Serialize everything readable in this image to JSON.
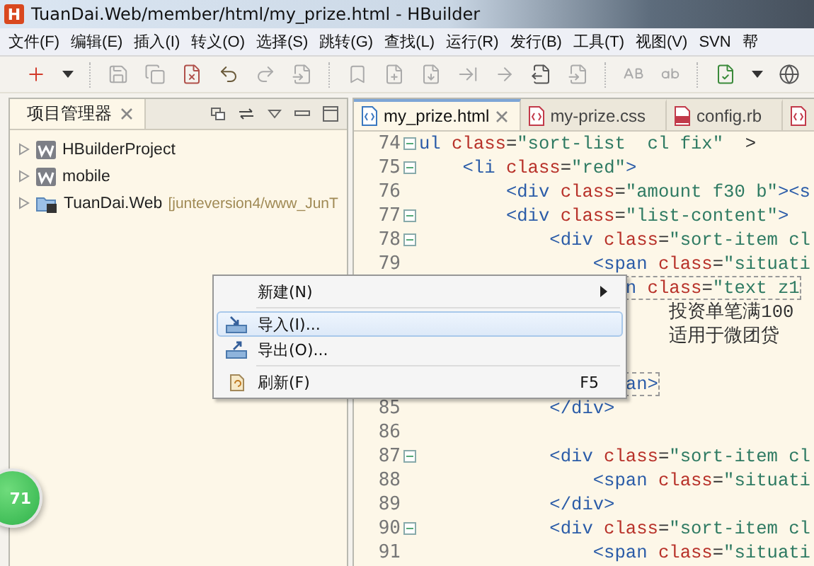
{
  "window": {
    "icon_letter": "H",
    "title": "TuanDai.Web/member/html/my_prize.html  -  HBuilder"
  },
  "menu_bar": [
    "文件(F)",
    "编辑(E)",
    "插入(I)",
    "转义(O)",
    "选择(S)",
    "跳转(G)",
    "查找(L)",
    "运行(R)",
    "发行(B)",
    "工具(T)",
    "视图(V)",
    "SVN",
    "帮"
  ],
  "project_panel": {
    "title": "项目管理器",
    "items": [
      {
        "kind": "web",
        "label": "HBuilderProject",
        "expanded": false
      },
      {
        "kind": "web",
        "label": "mobile",
        "expanded": false
      },
      {
        "kind": "linked",
        "label": "TuanDai.Web",
        "detail": "[junteversion4/www_JunT",
        "expanded": false
      }
    ]
  },
  "editor": {
    "tabs": [
      {
        "kind": "html",
        "label": "my_prize.html",
        "selected": true
      },
      {
        "kind": "css",
        "label": "my-prize.css",
        "selected": false
      },
      {
        "kind": "ruby",
        "label": "config.rb",
        "selected": false
      },
      {
        "kind": "css",
        "selected": false
      }
    ],
    "lines": [
      {
        "number": "74",
        "fold": true,
        "tokens": [
          {
            "kind": "tag",
            "text": "ul"
          },
          {
            "kind": "attr",
            "text": " class"
          },
          {
            "kind": "plain",
            "text": "="
          },
          {
            "kind": "str",
            "text": "\"sort-list  cl fix\""
          },
          {
            "kind": "plain",
            "text": "  >"
          }
        ]
      },
      {
        "number": "75",
        "fold": true,
        "tokens": [
          {
            "kind": "tag",
            "text": "    <li"
          },
          {
            "kind": "attr",
            "text": " class"
          },
          {
            "kind": "plain",
            "text": "="
          },
          {
            "kind": "str",
            "text": "\"red\""
          },
          {
            "kind": "tag",
            "text": ">"
          }
        ]
      },
      {
        "number": "76",
        "fold": false,
        "tokens": [
          {
            "kind": "tag",
            "text": "        <div"
          },
          {
            "kind": "attr",
            "text": " class"
          },
          {
            "kind": "plain",
            "text": "="
          },
          {
            "kind": "str",
            "text": "\"amount f30 b\""
          },
          {
            "kind": "tag",
            "text": "><s"
          }
        ]
      },
      {
        "number": "77",
        "fold": true,
        "tokens": [
          {
            "kind": "tag",
            "text": "        <div"
          },
          {
            "kind": "attr",
            "text": " class"
          },
          {
            "kind": "plain",
            "text": "="
          },
          {
            "kind": "str",
            "text": "\"list-content\""
          },
          {
            "kind": "tag",
            "text": ">"
          }
        ]
      },
      {
        "number": "78",
        "fold": true,
        "tokens": [
          {
            "kind": "tag",
            "text": "            <div"
          },
          {
            "kind": "attr",
            "text": " class"
          },
          {
            "kind": "plain",
            "text": "="
          },
          {
            "kind": "str",
            "text": "\"sort-item cl"
          }
        ]
      },
      {
        "number": "79",
        "fold": false,
        "tokens": [
          {
            "kind": "tag",
            "text": "                <span"
          },
          {
            "kind": "attr",
            "text": " class"
          },
          {
            "kind": "plain",
            "text": "="
          },
          {
            "kind": "str",
            "text": "\"situati"
          }
        ]
      },
      {
        "match": true,
        "tokens": [
          {
            "kind": "tag",
            "text": "                   n"
          },
          {
            "kind": "attr",
            "text": " class"
          },
          {
            "kind": "plain",
            "text": "="
          },
          {
            "kind": "str",
            "text": "\"text z1"
          }
        ]
      },
      {
        "tokens": [
          {
            "kind": "plain",
            "text": "                       投资单笔满100"
          }
        ]
      },
      {
        "tokens": [
          {
            "kind": "plain",
            "text": "                       适用于微团贷"
          }
        ]
      },
      {
        "gap_before": true,
        "match": true,
        "tokens": [
          {
            "kind": "tag",
            "text": "                   an>"
          }
        ]
      },
      {
        "number": "85",
        "fold": false,
        "tokens": [
          {
            "kind": "tag",
            "text": "            </div>"
          }
        ]
      },
      {
        "number": "86",
        "fold": false
      },
      {
        "number": "87",
        "fold": true,
        "tokens": [
          {
            "kind": "tag",
            "text": "            <div"
          },
          {
            "kind": "attr",
            "text": " class"
          },
          {
            "kind": "plain",
            "text": "="
          },
          {
            "kind": "str",
            "text": "\"sort-item cl"
          }
        ]
      },
      {
        "number": "88",
        "fold": false,
        "tokens": [
          {
            "kind": "tag",
            "text": "                <span"
          },
          {
            "kind": "attr",
            "text": " class"
          },
          {
            "kind": "plain",
            "text": "="
          },
          {
            "kind": "str",
            "text": "\"situati"
          }
        ]
      },
      {
        "number": "89",
        "fold": false,
        "tokens": [
          {
            "kind": "tag",
            "text": "            </div>"
          }
        ]
      },
      {
        "number": "90",
        "fold": true,
        "tokens": [
          {
            "kind": "tag",
            "text": "            <div"
          },
          {
            "kind": "attr",
            "text": " class"
          },
          {
            "kind": "plain",
            "text": "="
          },
          {
            "kind": "str",
            "text": "\"sort-item cl"
          }
        ]
      },
      {
        "number": "91",
        "fold": false,
        "tokens": [
          {
            "kind": "tag",
            "text": "                <span"
          },
          {
            "kind": "attr",
            "text": " class"
          },
          {
            "kind": "plain",
            "text": "="
          },
          {
            "kind": "str",
            "text": "\"situati"
          }
        ]
      }
    ]
  },
  "context_menu": {
    "items": [
      {
        "kind": "submenu",
        "label": "新建(N)",
        "selected": false
      },
      {
        "kind": "separator"
      },
      {
        "kind": "import",
        "label": "导入(I)...",
        "selected": true
      },
      {
        "kind": "export",
        "label": "导出(O)...",
        "selected": false
      },
      {
        "kind": "separator"
      },
      {
        "kind": "refresh",
        "label": "刷新(F)",
        "shortcut": "F5",
        "selected": false
      }
    ]
  },
  "badge": "71"
}
